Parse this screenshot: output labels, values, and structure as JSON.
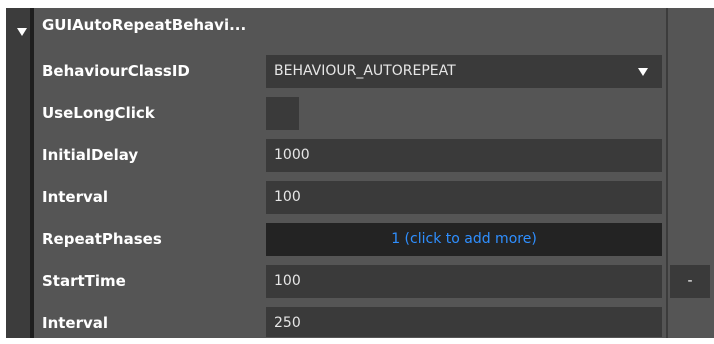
{
  "header": {
    "title": "GUIAutoRepeatBehavi..."
  },
  "properties": [
    {
      "label": "BehaviourClassID",
      "value": "BEHAVIOUR_AUTOREPEAT"
    },
    {
      "label": "UseLongClick",
      "value": ""
    },
    {
      "label": "InitialDelay",
      "value": "1000"
    },
    {
      "label": "Interval",
      "value": "100"
    },
    {
      "label": "RepeatPhases",
      "value": "1 (click to add more)"
    },
    {
      "label": "StartTime",
      "value": "100"
    },
    {
      "label": "Interval",
      "value": "250"
    }
  ],
  "remove_button_label": "-",
  "colors": {
    "panel_bg": "#555555",
    "field_bg": "#3a3a3a",
    "phases_bg": "#232323",
    "link_text": "#2f8fff"
  },
  "icons": {
    "collapse": "triangle-down-icon",
    "dropdown": "chevron-down-icon"
  }
}
